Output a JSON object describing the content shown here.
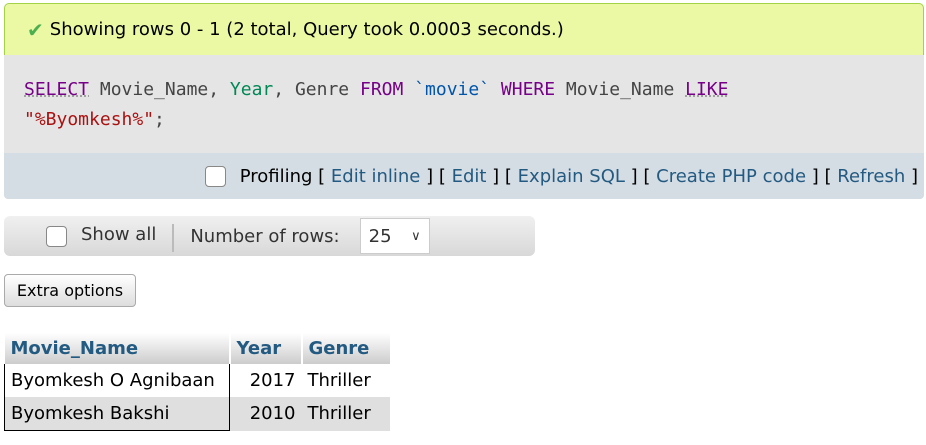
{
  "success": {
    "message": "Showing rows 0 - 1 (2 total, Query took 0.0003 seconds.)",
    "icon": "check-icon"
  },
  "sql": {
    "select": "SELECT",
    "fields1": " Movie_Name, ",
    "year": "Year",
    "fields2": ", Genre ",
    "from": "FROM",
    "table": "`movie`",
    "where": "WHERE",
    "col": " Movie_Name ",
    "like": "LIKE",
    "value": "\"%Byomkesh%\"",
    "end": ";"
  },
  "profiling": {
    "label": "Profiling",
    "links": [
      "Edit inline",
      "Edit",
      "Explain SQL",
      "Create PHP code",
      "Refresh"
    ]
  },
  "nav": {
    "show_all": "Show all",
    "rows_label": "Number of rows:",
    "rows_value": "25"
  },
  "extra_options": "Extra options",
  "table": {
    "headers": [
      "Movie_Name",
      "Year",
      "Genre"
    ],
    "rows": [
      [
        "Byomkesh O Agnibaan",
        "2017",
        "Thriller"
      ],
      [
        "Byomkesh Bakshi",
        "2010",
        "Thriller"
      ]
    ]
  }
}
